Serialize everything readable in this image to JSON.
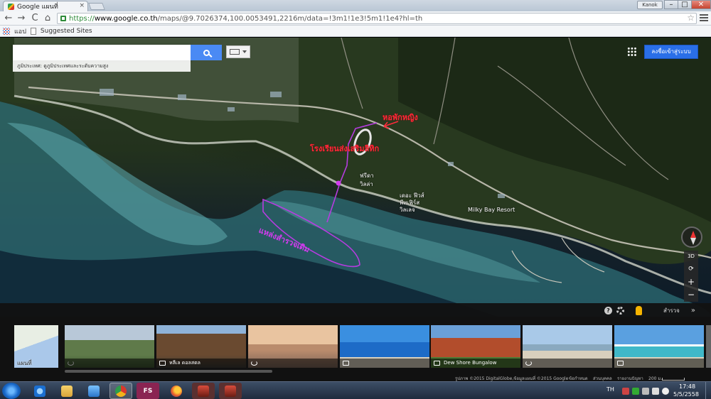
{
  "browser": {
    "tab_title": "Google แผนที่",
    "url_scheme": "https://",
    "url_host": "www.google.co.th",
    "url_path": "/maps/@9.7026374,100.0053491,2216m/data=!3m1!1e3!5m1!1e4?hl=th",
    "user_label": "Kanok",
    "win_minimize": "–",
    "win_maximize": "□",
    "win_close": "✕",
    "back": "←",
    "forward": "→",
    "reload": "C",
    "home": "⌂",
    "star": "☆",
    "bookmarks": {
      "apps_label": "แอป",
      "suggested_label": "Suggested Sites"
    }
  },
  "map": {
    "search_placeholder": "",
    "search_hint": "ภูมิประเทศ: ดูภูมิประเทศและระดับความสูง",
    "signin_label": "ลงชื่อเข้าสู่ระบบ",
    "labels": {
      "place1": "ฟรีดา",
      "place2": "วิลล่า",
      "place3": "เดอะ ฟีวส์",
      "place4": "พีทเฟิร์ส",
      "place5": "วิลเลจ",
      "milky_bay": "Milky Bay Resort"
    },
    "annotations": {
      "red_top": "หอพักหญิง",
      "red_middle": "โรงเรียนส่งเสริมลิทิก",
      "purple": "แหล่งสำรวจเดิม"
    },
    "controls": {
      "tilt": "3D",
      "rotate": "⟳",
      "zoom_in": "+",
      "zoom_out": "−"
    }
  },
  "panel": {
    "help": "?",
    "explore_label": "สำรวจ",
    "chevron": "»",
    "map_thumb_label": "แผนที่",
    "thumbs": [
      {
        "caption": ""
      },
      {
        "caption": "หลีเล ดอลสตล"
      },
      {
        "caption": ""
      },
      {
        "caption": ""
      },
      {
        "caption": "Dew Shore Bungalow"
      },
      {
        "caption": ""
      },
      {
        "caption": ""
      }
    ],
    "footer": {
      "imagery": "รูปภาพ ©2015 DigitalGlobe,ข้อมูลแผนที่ ©2015 Google",
      "terms": "ข้อกำหนด",
      "privacy": "ส่วนบุคคล",
      "report": "รายงานปัญหา",
      "scale": "200 ม."
    }
  },
  "taskbar": {
    "fs_label": "FS",
    "lang": "TH",
    "time": "17:48",
    "date": "5/5/2558"
  },
  "colors": {
    "annotation_red": "#ff2a3a",
    "annotation_purple": "#d43cf0",
    "signin_blue": "#2a6fe8",
    "search_blue": "#4a8af4"
  }
}
